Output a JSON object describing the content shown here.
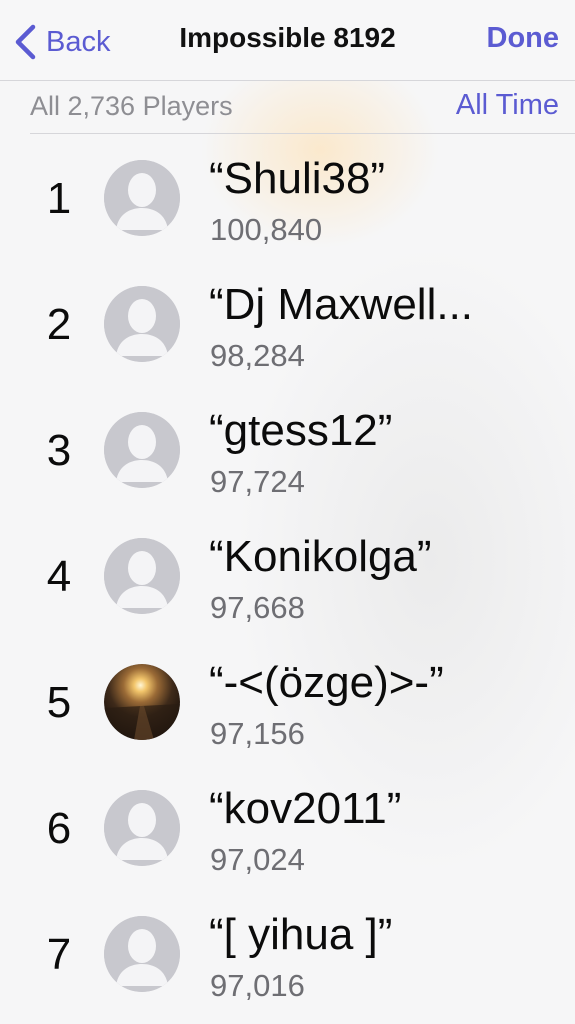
{
  "navbar": {
    "back_label": "Back",
    "title": "Impossible 8192",
    "done_label": "Done"
  },
  "filter": {
    "player_scope": "All 2,736 Players",
    "time_scope": "All Time"
  },
  "colors": {
    "accent": "#5b5bd2",
    "secondary_text": "#8e8e93",
    "avatar_placeholder": "#c8c8ce"
  },
  "leaderboard": [
    {
      "rank": "1",
      "name": "“Shuli38”",
      "score": "100,840",
      "avatar": "placeholder-avatar-icon"
    },
    {
      "rank": "2",
      "name": "“Dj Maxwell...",
      "score": "98,284",
      "avatar": "placeholder-avatar-icon"
    },
    {
      "rank": "3",
      "name": "“gtess12”",
      "score": "97,724",
      "avatar": "placeholder-avatar-icon"
    },
    {
      "rank": "4",
      "name": "“Konikolga”",
      "score": "97,668",
      "avatar": "placeholder-avatar-icon"
    },
    {
      "rank": "5",
      "name": "“-<(özge)>-”",
      "score": "97,156",
      "avatar": "sunset-photo"
    },
    {
      "rank": "6",
      "name": "“kov2011”",
      "score": "97,024",
      "avatar": "placeholder-avatar-icon"
    },
    {
      "rank": "7",
      "name": "“[ yihua ]”",
      "score": "97,016",
      "avatar": "placeholder-avatar-icon"
    }
  ]
}
